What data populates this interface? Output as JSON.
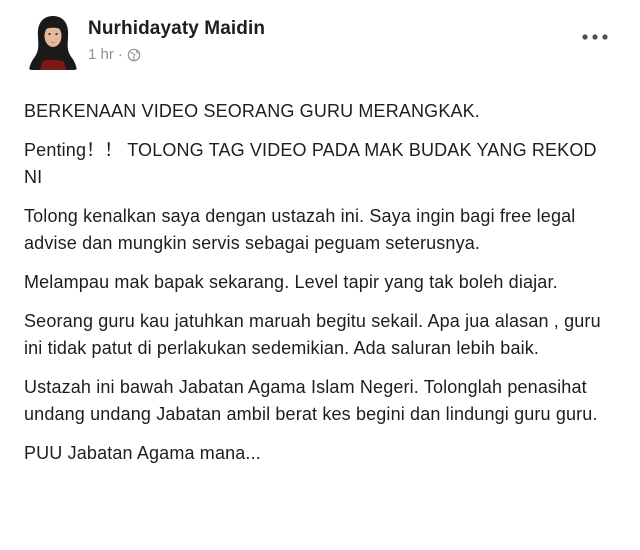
{
  "post": {
    "author": "Nurhidayaty Maidin",
    "time": "1 hr",
    "separator": "·",
    "privacy_icon": "globe-icon",
    "menu_icon": "more-options-icon",
    "paragraphs": [
      "BERKENAAN VIDEO SEORANG GURU MERANGKAK.",
      "Penting！！ TOLONG TAG VIDEO PADA MAK BUDAK YANG REKOD NI",
      "Tolong kenalkan saya dengan ustazah ini. Saya ingin bagi free legal advise dan mungkin servis sebagai peguam seterusnya.",
      "Melampau mak bapak sekarang. Level tapir yang tak boleh diajar.",
      "Seorang guru kau jatuhkan maruah begitu sekail. Apa jua alasan , guru ini tidak patut di perlakukan sedemikian. Ada saluran lebih baik.",
      "Ustazah ini bawah Jabatan Agama Islam Negeri. Tolonglah penasihat undang undang Jabatan ambil berat kes begini dan lindungi guru guru.",
      "PUU Jabatan Agama mana..."
    ]
  },
  "colors": {
    "text": "#1c1e21",
    "meta": "#90949c",
    "avatar_hijab": "#1a1a1a",
    "avatar_skin": "#e6b99a",
    "avatar_lips": "#c0392b"
  }
}
